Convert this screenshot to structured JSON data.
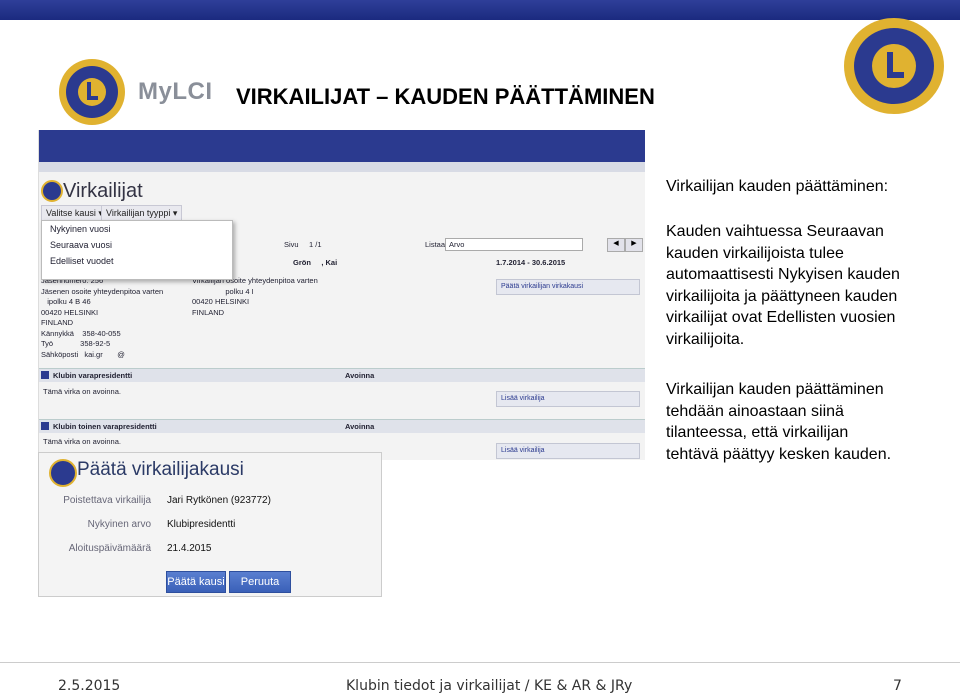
{
  "brand": {
    "product": "MyLCI"
  },
  "header": {
    "title": "VIRKAILIJAT – KAUDEN PÄÄTTÄMINEN"
  },
  "screenshot": {
    "page_title": "Virkailijat",
    "select_season_button": "Valitse kausi ▾",
    "officer_type_button": "Virkailijan tyyppi ▾",
    "season_menu": [
      "Nykyinen vuosi",
      "Seuraava vuosi",
      "Edelliset vuodet"
    ],
    "member_info": "Jäsennumero: 256\nJäsenen osoite yhteydenpitoa varten\n   ipolku 4 B 46\n00420 HELSINKI\nFINLAND\nKännykkä    358-40-055\nTyö             358-92-5\nSähköposti   kai.gr       @",
    "officer_address": "Virkailijan osoite yhteydenpitoa varten\n                polku 4 I\n00420 HELSINKI\nFINLAND",
    "end_term_link": "Päätä virkailijan virkakausi",
    "add_officer_link_1": "Lisää virkailija",
    "add_officer_link_2": "Lisää virkailija",
    "section_1_title": "Klubin varapresidentti",
    "section_1_status": "Avoinna",
    "section_1_note": "Tämä virka on avoinna.",
    "section_2_title": "Klubin toinen varapresidentti",
    "section_2_status": "Avoinna",
    "section_2_note": "Tämä virka on avoinna.",
    "page_label": "Sivu",
    "page_value": "1 /1",
    "list_label": "Listaa",
    "list_value": "Arvo",
    "row_name": "Grön     , Kai",
    "row_dates": "1.7.2014 - 30.6.2015"
  },
  "dialog": {
    "title": "Päätä virkailijakausi",
    "rows": [
      {
        "label": "Poistettava virkailija",
        "value": "Jari Rytkönen (923772)"
      },
      {
        "label": "Nykyinen arvo",
        "value": "Klubipresidentti"
      },
      {
        "label": "Aloituspäivämäärä",
        "value": "21.4.2015"
      }
    ],
    "end_button": "Päätä kausi",
    "cancel_button": "Peruuta"
  },
  "explanation": {
    "heading": "Virkailijan kauden päättäminen:",
    "paragraph1": "Kauden vaihtuessa Seuraavan\nkauden virkailijoista tulee\nautomaattisesti Nykyisen kauden\nvirkailijoita ja päättyneen kauden\nvirkailijat ovat Edellisten vuosien\nvirkailijoita.",
    "paragraph2": "Virkailijan kauden päättäminen\ntehdään ainoastaan siinä\ntilanteessa, että virkailijan\ntehtävä päättyy kesken kauden."
  },
  "footer": {
    "date": "2.5.2015",
    "center": "Klubin tiedot ja virkailijat / KE & AR & JRy",
    "page": "7"
  },
  "colors": {
    "lions_blue": "#2b3a8f",
    "lions_gold": "#e0b230",
    "button_blue": "#3a60b8"
  }
}
